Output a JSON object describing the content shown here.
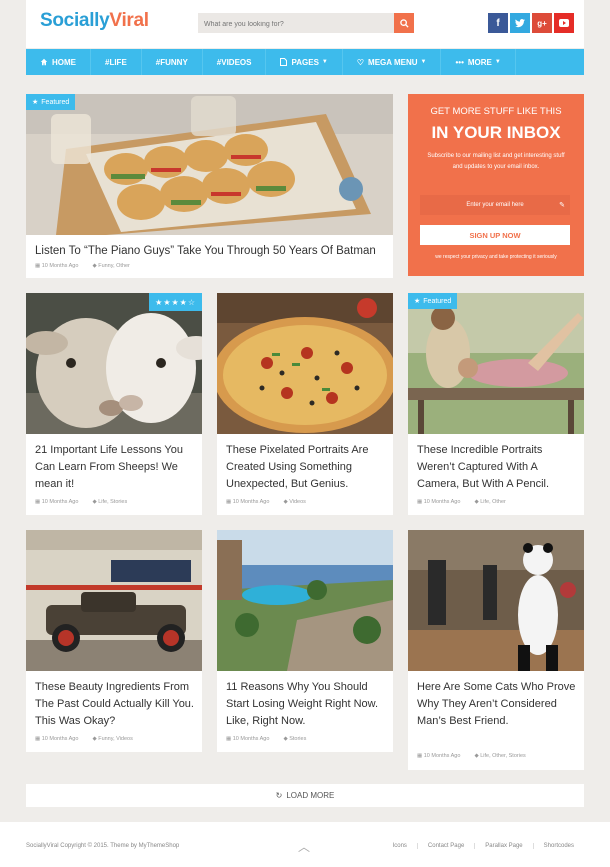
{
  "header": {
    "logo_part1": "Socially",
    "logo_part2": "Viral",
    "search_placeholder": "What are you looking for?",
    "social": [
      "f",
      "t",
      "g+",
      "yt"
    ]
  },
  "nav": {
    "items": [
      "HOME",
      "#LIFE",
      "#FUNNY",
      "#VIDEOS",
      "PAGES",
      "MEGA MENU",
      "MORE"
    ]
  },
  "featured": {
    "badge": "Featured",
    "title": "Listen To “The Piano Guys” Take You Through 50 Years Of Batman",
    "date": "10 Months Ago",
    "categories": "Funny, Other"
  },
  "newsletter": {
    "line1": "GET MORE STUFF LIKE THIS",
    "line2": "IN YOUR INBOX",
    "description": "Subscribe to our mailing list and get interesting stuff and updates to your email inbox.",
    "email_placeholder": "Enter your email here",
    "button": "SIGN UP NOW",
    "privacy": "we respect your privacy and take protecting it seriously"
  },
  "posts": [
    {
      "title": "21 Important Life Lessons You Can Learn From Sheeps! We mean it!",
      "date": "10 Months Ago",
      "categories": "Life, Stories",
      "stars": "★★★★☆"
    },
    {
      "title": "These Pixelated Portraits Are Created Using Something Unexpected, But Genius.",
      "date": "10 Months Ago",
      "categories": "Videos"
    },
    {
      "title": "These Incredible Portraits Weren’t Captured With A Camera, But With A Pencil.",
      "date": "10 Months Ago",
      "categories": "Life, Other",
      "badge": "Featured"
    },
    {
      "title": "These Beauty Ingredients From The Past Could Actually Kill You. This Was Okay?",
      "date": "10 Months Ago",
      "categories": "Funny, Videos"
    },
    {
      "title": "11 Reasons Why You Should Start Losing Weight Right Now. Like, Right Now.",
      "date": "10 Months Ago",
      "categories": "Stories"
    },
    {
      "title": "Here Are Some Cats Who Prove Why They Aren’t Considered Man’s Best Friend.",
      "date": "10 Months Ago",
      "categories": "Life, Other, Stories"
    }
  ],
  "load_more": "LOAD MORE",
  "footer": {
    "copyright": "SociallyViral Copyright © 2015. Theme by MyThemeShop",
    "links": [
      "Icons",
      "Contact Page",
      "Parallax Page",
      "Shortcodes"
    ]
  },
  "colors": {
    "accent_blue": "#3dbbec",
    "accent_orange": "#f1714b"
  }
}
